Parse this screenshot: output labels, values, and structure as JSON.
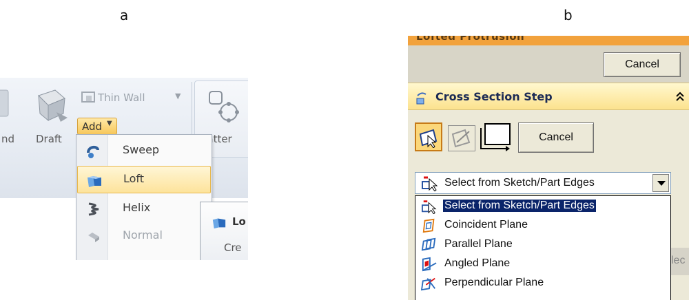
{
  "labels": {
    "a": "a",
    "b": "b"
  },
  "panel_a": {
    "ribbon": {
      "partial_left_label": "nd",
      "draft_label": "Draft",
      "thin_wall_label": "Thin Wall",
      "add_label": "Add",
      "pattern_label": "Patter"
    },
    "add_menu": [
      {
        "label": "Sweep",
        "icon": "sweep-icon",
        "state": "normal"
      },
      {
        "label": "Loft",
        "icon": "loft-icon",
        "state": "selected"
      },
      {
        "label": "Helix",
        "icon": "helix-icon",
        "state": "normal"
      },
      {
        "label": "Normal",
        "icon": "normal-icon",
        "state": "disabled"
      }
    ],
    "tooltip": {
      "title": "Lo",
      "body": "Cre"
    }
  },
  "panel_b": {
    "title": "Lofted Protrusion",
    "top_cancel_label": "Cancel",
    "step_title": "Cross Section Step",
    "step_cancel_label": "Cancel",
    "combo_value": "Select from Sketch/Part Edges",
    "right_edge_text": "lec",
    "list_items": [
      {
        "label": "Select from Sketch/Part Edges",
        "icon": "sketch-edges-icon",
        "selected": true
      },
      {
        "label": "Coincident Plane",
        "icon": "coincident-plane-icon",
        "selected": false
      },
      {
        "label": "Parallel Plane",
        "icon": "parallel-plane-icon",
        "selected": false
      },
      {
        "label": "Angled Plane",
        "icon": "angled-plane-icon",
        "selected": false
      },
      {
        "label": "Perpendicular Plane",
        "icon": "perpendicular-plane-icon",
        "selected": false
      }
    ],
    "colors": {
      "title_bar": "#f2a23c",
      "selection": "#0a246a",
      "step_header": "#fce28e"
    }
  }
}
